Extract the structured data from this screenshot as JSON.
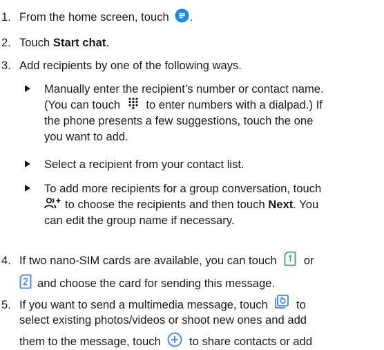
{
  "steps": [
    {
      "num": "1.",
      "text_before": "From the home screen, touch",
      "text_after": ".",
      "icon": "messages-icon"
    },
    {
      "num": "2.",
      "text_before": "Touch ",
      "bold": "Start chat",
      "text_after": "."
    },
    {
      "num": "3.",
      "text": "Add recipients by one of the following ways."
    },
    {
      "num": "4.",
      "line1_before": "If two nano-SIM cards are available, you can touch",
      "line1_after": "or",
      "line2_after": "and choose the card for sending this message.",
      "icons": [
        "sim-1-icon",
        "sim-2-icon"
      ]
    },
    {
      "num": "5.",
      "line1_before": "If you want to send a multimedia message, touch",
      "line1_after": "to",
      "line2": "select existing photos/videos or shoot new ones and add",
      "line3_before": "them to the message, touch",
      "line3_after": "to share contacts or add",
      "icons": [
        "gallery-icon",
        "add-circle-icon"
      ]
    }
  ],
  "bullets": [
    {
      "line1": "Manually enter the recipient’s number or contact name.",
      "line2_before": "(You can touch",
      "line2_after": "to enter numbers with a dialpad.) If",
      "line3": "the phone presents a few suggestions, touch the one",
      "line4": "you want to add.",
      "icon": "dialpad-icon"
    },
    {
      "line1": "Select a recipient from your contact list."
    },
    {
      "line1": "To add more recipients for a group conversation, touch",
      "line2_before": "",
      "line2_mid": "to choose the recipients and then touch ",
      "line2_bold": "Next",
      "line2_after": ". You",
      "line3": "can edit the group name if necessary.",
      "icon": "add-group-icon"
    }
  ],
  "colors": {
    "text": "#1a1a1a",
    "accent": "#1e88e5",
    "sim_green": "#3aa55a",
    "sim_blue": "#3b82f6"
  }
}
